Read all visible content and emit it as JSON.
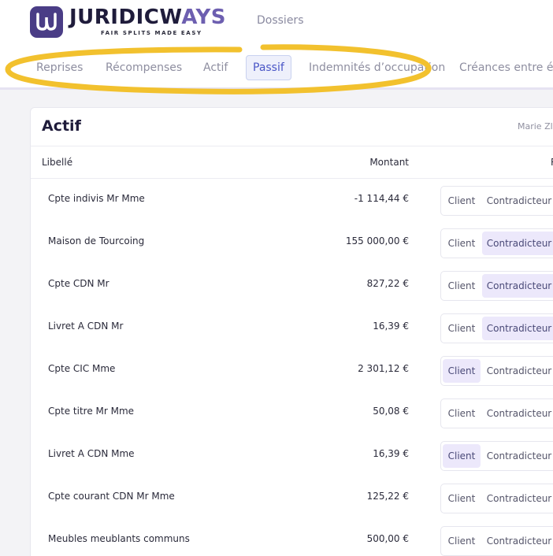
{
  "header": {
    "brand_main": "JURIDICW",
    "brand_accent": "AYS",
    "tagline": "FAIR SPLITS MADE EASY",
    "nav_dossiers": "Dossiers"
  },
  "tabs": [
    {
      "label": "Reprises"
    },
    {
      "label": "Récompenses"
    },
    {
      "label": "Actif"
    },
    {
      "label": "Passif",
      "active": true
    },
    {
      "label": "Indemnités d’occupation"
    },
    {
      "label": "Créances entre ép"
    }
  ],
  "card": {
    "title": "Actif",
    "user": "Marie Zl",
    "columns": {
      "libelle": "Libellé",
      "montant": "Montant",
      "r": "R"
    },
    "rows": [
      {
        "label": "Cpte indivis Mr Mme",
        "amount": "-1 114,44 €",
        "client": "Client",
        "contra": "Contradicteur",
        "selected": "none"
      },
      {
        "label": "Maison de Tourcoing",
        "amount": "155 000,00 €",
        "client": "Client",
        "contra": "Contradicteur",
        "selected": "contradicteur"
      },
      {
        "label": "Cpte CDN Mr",
        "amount": "827,22 €",
        "client": "Client",
        "contra": "Contradicteur",
        "selected": "contradicteur"
      },
      {
        "label": "Livret A CDN Mr",
        "amount": "16,39 €",
        "client": "Client",
        "contra": "Contradicteur",
        "selected": "contradicteur"
      },
      {
        "label": "Cpte CIC Mme",
        "amount": "2 301,12 €",
        "client": "Client",
        "contra": "Contradicteur",
        "selected": "client"
      },
      {
        "label": "Cpte titre Mr Mme",
        "amount": "50,08 €",
        "client": "Client",
        "contra": "Contradicteur",
        "selected": "none"
      },
      {
        "label": "Livret A CDN Mme",
        "amount": "16,39 €",
        "client": "Client",
        "contra": "Contradicteur",
        "selected": "client"
      },
      {
        "label": "Cpte courant CDN Mr Mme",
        "amount": "125,22 €",
        "client": "Client",
        "contra": "Contradicteur",
        "selected": "none"
      },
      {
        "label": "Meubles meublants communs",
        "amount": "500,00 €",
        "client": "Client",
        "contra": "Contradicteur",
        "selected": "none"
      }
    ]
  },
  "colors": {
    "brand": "#4a3d86",
    "highlight": "#f2c12e",
    "selected": "#ece8fb"
  }
}
